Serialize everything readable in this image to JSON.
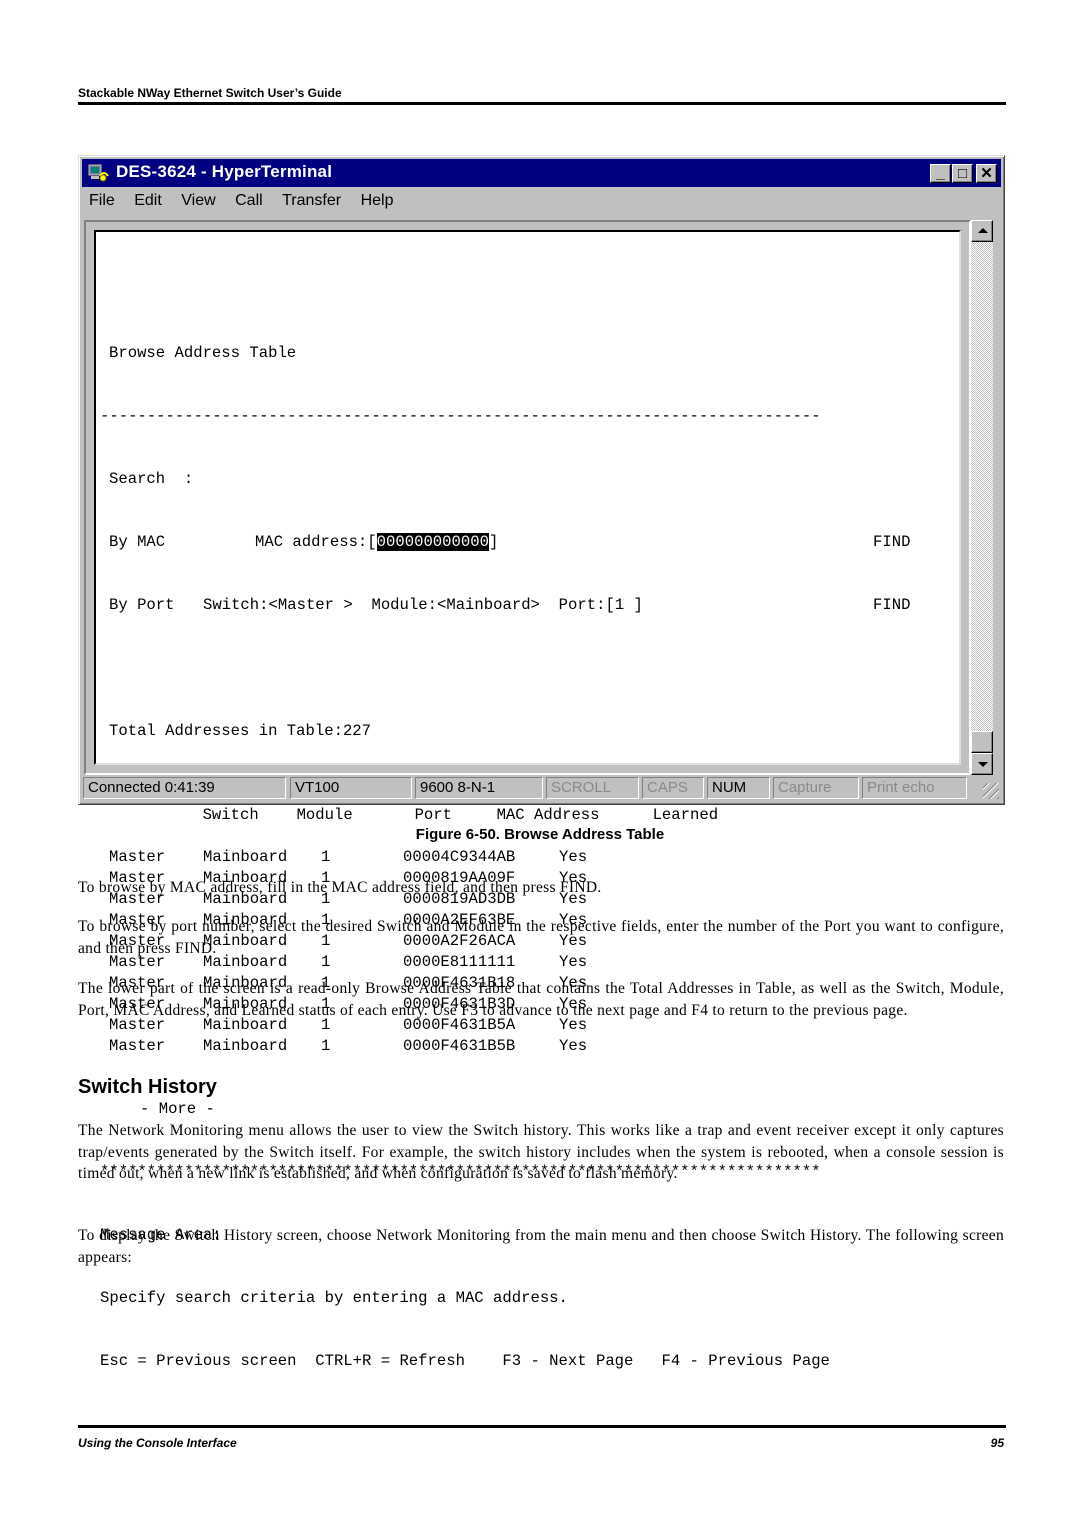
{
  "page": {
    "header": "Stackable NWay Ethernet Switch User’s Guide",
    "footer_left": "Using the Console Interface",
    "footer_right": "95"
  },
  "window": {
    "title": "DES-3624 - HyperTerminal",
    "icon": "hyperterminal-app-icon",
    "controls": {
      "minimize": "_",
      "maximize": "□",
      "close": "✕"
    },
    "menu": [
      "File",
      "Edit",
      "View",
      "Call",
      "Transfer",
      "Help"
    ],
    "status": {
      "connected": "Connected 0:41:39",
      "emulation": "VT100",
      "settings": "9600 8-N-1",
      "scroll": "SCROLL",
      "caps": "CAPS",
      "num": "NUM",
      "capture": "Capture",
      "print_echo": "Print echo"
    }
  },
  "terminal": {
    "screen_title": "Browse Address Table",
    "dash_line": "-----------------------------------------------------------------------------",
    "search_label": "Search  :",
    "by_mac_label": "By MAC",
    "mac_address_label": "MAC address:",
    "mac_address_value": "000000000000",
    "by_port_label": "By Port",
    "switch_label": "Switch:",
    "switch_value": "<Master >",
    "module_label": "Module:",
    "module_value": "<Mainboard>",
    "port_label": "Port:",
    "port_value": "[1 ]",
    "find_label": "FIND",
    "total_label": "Total Addresses in Table:",
    "total_value": "227",
    "columns": [
      "Switch",
      "Module",
      "Port",
      "MAC Address",
      "Learned"
    ],
    "rows": [
      [
        "Master",
        "Mainboard",
        "1",
        "00004C9344AB",
        "Yes"
      ],
      [
        "Master",
        "Mainboard",
        "1",
        "0000819AA09F",
        "Yes"
      ],
      [
        "Master",
        "Mainboard",
        "1",
        "0000819AD3DB",
        "Yes"
      ],
      [
        "Master",
        "Mainboard",
        "1",
        "0000A2EF63BE",
        "Yes"
      ],
      [
        "Master",
        "Mainboard",
        "1",
        "0000A2F26ACA",
        "Yes"
      ],
      [
        "Master",
        "Mainboard",
        "1",
        "0000E8111111",
        "Yes"
      ],
      [
        "Master",
        "Mainboard",
        "1",
        "0000F4631B18",
        "Yes"
      ],
      [
        "Master",
        "Mainboard",
        "1",
        "0000F4631B3D",
        "Yes"
      ],
      [
        "Master",
        "Mainboard",
        "1",
        "0000F4631B5A",
        "Yes"
      ],
      [
        "Master",
        "Mainboard",
        "1",
        "0000F4631B5B",
        "Yes"
      ]
    ],
    "more": "- More -",
    "star_line": "*****************************************************************************",
    "message_area_label": "Message Area:",
    "message": "Specify search criteria by entering a MAC address.",
    "help_line": "Esc = Previous screen  CTRL+R = Refresh    F3 - Next Page   F4 - Previous Page"
  },
  "document": {
    "figure_caption": "Figure 6-50.  Browse Address Table",
    "paragraphs_1": [
      "To browse by MAC address, fill in the MAC address field, and then press FIND.",
      "To browse by port number, select the desired Switch and Module in the respective fields, enter the number of the Port you want to configure, and then press FIND.",
      "The lower part of the screen is a read-only Browse Address Table that contains the Total Addresses in Table, as well as the Switch, Module, Port, MAC Address, and Learned status of each entry. Use F3 to advance to the next page and F4 to return to the previous page."
    ],
    "section_heading": "Switch History",
    "paragraphs_2": [
      "The Network Monitoring menu allows the user to view the Switch history. This works like a trap and event receiver except it only captures trap/events generated by the Switch itself. For example, the switch history includes when the system is rebooted, when a console session is timed out, when a new link  is established, and when configuration is saved to flash memory.",
      "To display the Switch History screen, choose Network Monitoring from the main menu and then choose Switch History. The following screen appears:"
    ]
  }
}
